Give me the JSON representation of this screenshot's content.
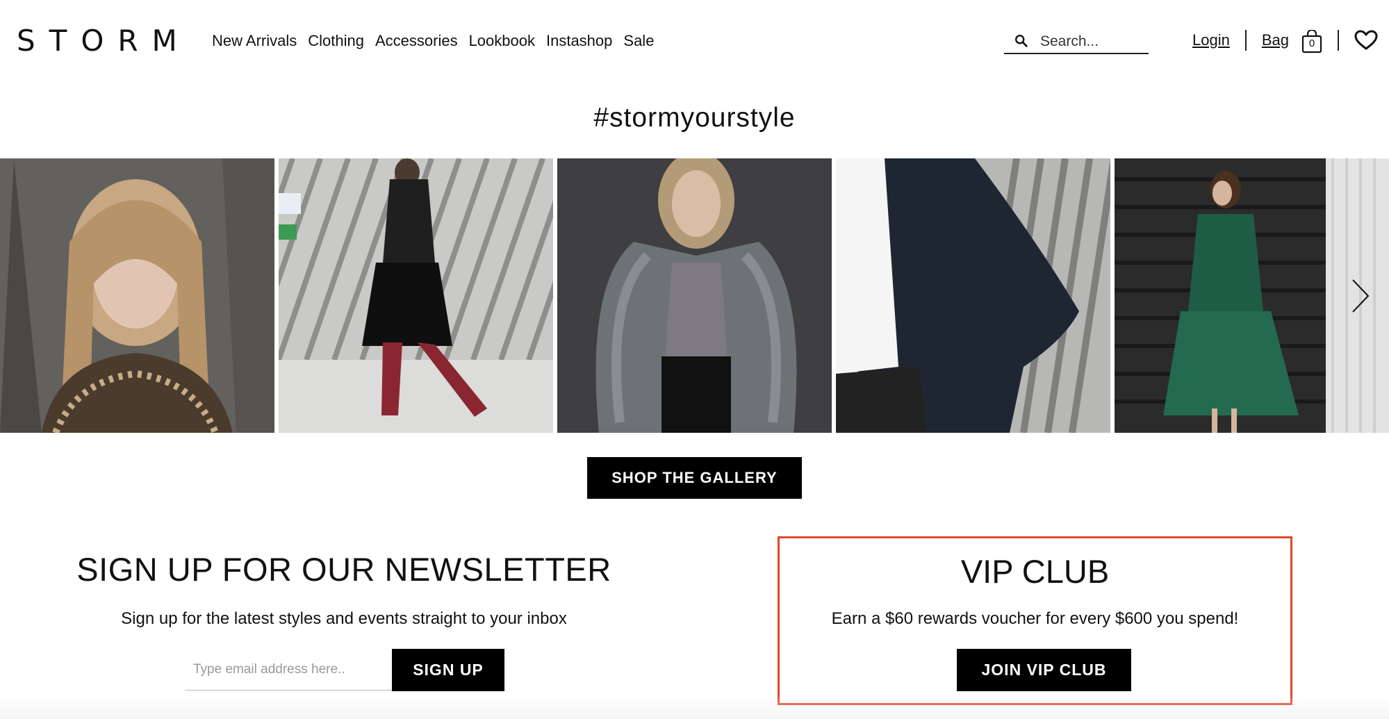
{
  "header": {
    "logo": "STORM",
    "nav": [
      "New Arrivals",
      "Clothing",
      "Accessories",
      "Lookbook",
      "Instashop",
      "Sale"
    ],
    "search_placeholder": "Search...",
    "login": "Login",
    "bag": "Bag",
    "bag_count": "0"
  },
  "gallery": {
    "hashtag": "#stormyourstyle",
    "shop_button": "SHOP THE GALLERY"
  },
  "newsletter": {
    "title": "SIGN UP FOR OUR NEWSLETTER",
    "subtitle": "Sign up for the latest styles and events straight to your inbox",
    "email_placeholder": "Type email address here..",
    "button": "SIGN UP"
  },
  "vip": {
    "title": "VIP CLUB",
    "subtitle": "Earn a $60 rewards voucher for every $600 you spend!",
    "button": "JOIN VIP CLUB",
    "highlight_color": "#e1462c"
  }
}
